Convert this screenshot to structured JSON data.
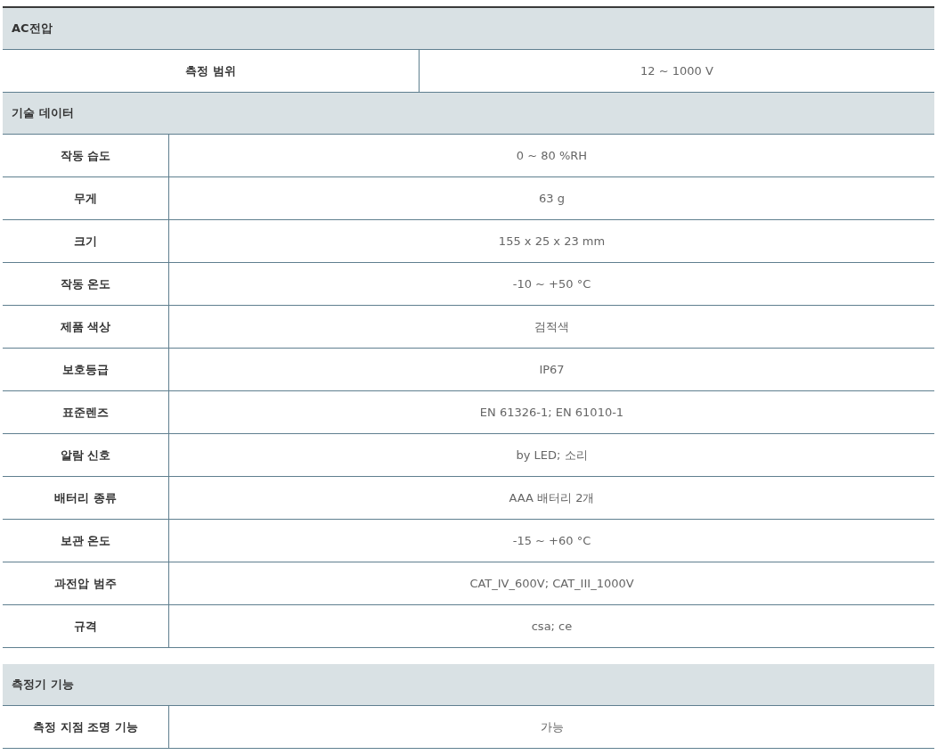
{
  "tables": [
    {
      "sections": [
        {
          "title": "AC전압",
          "kind": "half",
          "rows": [
            {
              "label": "측정 범위",
              "value": "12 ~ 1000 V"
            }
          ]
        },
        {
          "title": "기술 데이터",
          "kind": "narrow",
          "rows": [
            {
              "label": "작동 습도",
              "value": "0 ~ 80 %RH"
            },
            {
              "label": "무게",
              "value": "63 g"
            },
            {
              "label": "크기",
              "value": "155 x 25 x 23 mm"
            },
            {
              "label": "작동 온도",
              "value": "-10 ~ +50 °C"
            },
            {
              "label": "제품 색상",
              "value": "검적색"
            },
            {
              "label": "보호등급",
              "value": "IP67"
            },
            {
              "label": "표준렌즈",
              "value": "EN 61326-1; EN 61010-1"
            },
            {
              "label": "알람 신호",
              "value": "by LED; 소리"
            },
            {
              "label": "배터리 종류",
              "value": "AAA 배터리 2개"
            },
            {
              "label": "보관 온도",
              "value": "-15 ~ +60 °C"
            },
            {
              "label": "과전압 범주",
              "value": "CAT_IV_600V; CAT_III_1000V"
            },
            {
              "label": "규격",
              "value": "csa; ce"
            }
          ]
        }
      ]
    },
    {
      "sections": [
        {
          "title": "측정기 기능",
          "kind": "narrow",
          "rows": [
            {
              "label": "측정 지점 조명 기능",
              "value": "가능"
            }
          ]
        }
      ]
    }
  ]
}
